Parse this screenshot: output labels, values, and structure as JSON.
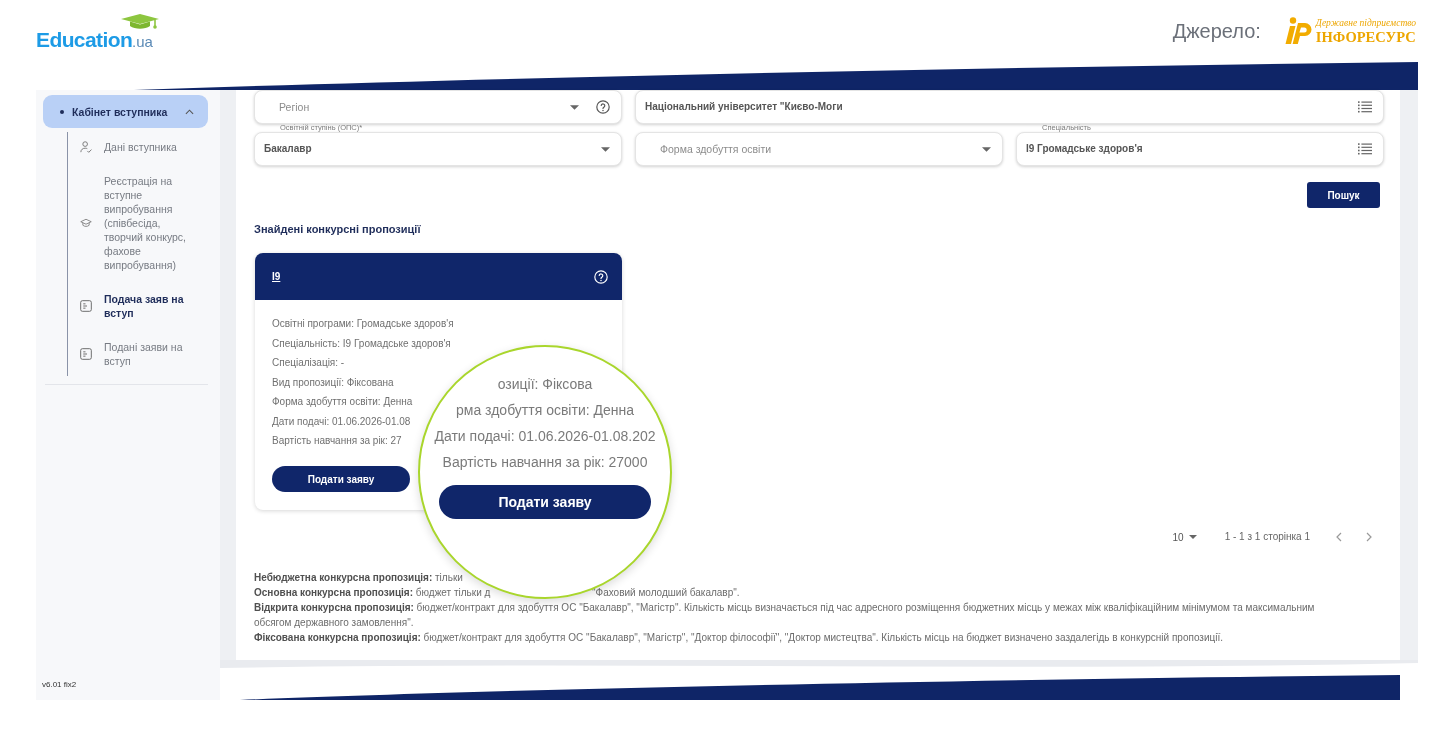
{
  "header": {
    "logo": {
      "name": "Education",
      "suffix": ".ua"
    },
    "source": {
      "label": "Джерело:",
      "tagline": "Державне підприємство",
      "name": "ІНФОРЕСУРС"
    }
  },
  "sidebar": {
    "group": {
      "label": "Кабінет вступника",
      "selected": true,
      "expanded": true
    },
    "items": [
      {
        "label": "Дані вступника",
        "selected": false
      },
      {
        "label": "Реєстрація на вступне випробування (співбесіда, творчий конкурс, фахове випробування)",
        "selected": false
      },
      {
        "label": "Подача заяв на вступ",
        "selected": true
      },
      {
        "label": "Подані заяви на вступ",
        "selected": false
      }
    ],
    "version": "v6.01 fix2"
  },
  "filters": {
    "rows": [
      [
        {
          "kind": "dropdown",
          "placeholder": "Регіон",
          "help": true
        },
        {
          "kind": "picker",
          "value": "Національний університет \"Києво-Моги"
        }
      ],
      [
        {
          "kind": "dropdown",
          "label": "Освітній ступінь (ОПС)*",
          "value": "Бакалавр"
        },
        {
          "kind": "dropdown",
          "placeholder": "Форма здобуття освіти"
        },
        {
          "kind": "picker",
          "label": "Спеціальність",
          "value": "I9 Громадське здоров'я"
        }
      ]
    ],
    "search_button": "Пошук"
  },
  "results": {
    "title": "Знайдені конкурсні пропозиції",
    "cards": [
      {
        "code": "I9",
        "details": [
          "Освітні програми: Громадське здоров'я",
          "Спеціальність: I9 Громадське здоров'я",
          "Спеціалізація: -",
          "Вид пропозиції: Фіксована",
          "Форма здобуття освіти: Денна",
          "Дати подачі: 01.06.2026-01.08",
          "Вартість навчання за рік: 27"
        ],
        "button": "Подати заяву"
      }
    ]
  },
  "magnifier": {
    "lines": [
      "озиції: Фіксова",
      "рма здобуття освіти: Денна",
      "Дати подачі: 01.06.2026-01.08.202",
      "Вартість навчання за рік: 27000"
    ],
    "button": "Подати заяву"
  },
  "pagination": {
    "page_size": "10",
    "range": "1 - 1 з 1 сторінка 1"
  },
  "legend": [
    {
      "text": "**Небюджетна конкурсна пропозиція:** тільки"
    },
    {
      "text": "**Основна конкурсна пропозиція:** бюджет тільки д",
      "continuation": "\"Фаховий молодший бакалавр\"."
    },
    {
      "text": "**Відкрита конкурсна пропозиція:** бюджет/контракт для здобуття ОС \"Бакалавр\", \"Магістр\". Кількість місць визначається під час адресного розміщення бюджетних місць у межах між кваліфікаційним мінімумом та максимальним обсягом державного замовлення\"."
    },
    {
      "text": "**Фіксована конкурсна пропозиція:** бюджет/контракт для здобуття ОС \"Бакалавр\", \"Магістр\", \"Доктор філософії\", \"Доктор мистецтва\". Кількість місць на бюджет визначено заздалегідь в конкурсній пропозиції."
    }
  ]
}
